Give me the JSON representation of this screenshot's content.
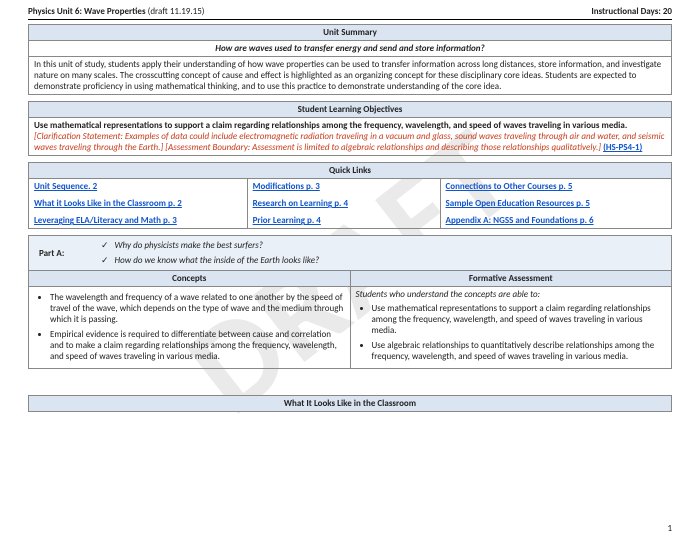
{
  "header": {
    "title_bold": "Physics Unit 6: Wave Properties",
    "title_paren": " (draft 11.19.15)",
    "right": "Instructional Days: 20"
  },
  "summary": {
    "band": "Unit Summary",
    "question": "How are waves used to transfer energy and send and store information?",
    "body": "In this unit of study, students apply their understanding of how wave properties can be used to transfer information across long distances, store information, and investigate nature on many scales. The crosscutting concept of cause and effect is highlighted as an organizing concept for these disciplinary core ideas. Students are expected to demonstrate proficiency in using mathematical thinking, and to use this practice to demonstrate understanding of the core idea."
  },
  "slo": {
    "band": "Student Learning Objectives",
    "main": "Use mathematical representations to support a claim regarding relationships among the frequency, wavelength, and speed of waves traveling in various media.",
    "clarification": "[Clarification Statement:  Examples of data could include electromagnetic radiation traveling in a vacuum and glass, sound waves traveling through air and water, and seismic waves traveling through the Earth.] [Assessment Boundary:  Assessment is limited to algebraic relationships and describing those relationships qualitatively.]",
    "code": "(HS-PS4-1)"
  },
  "quicklinks": {
    "band": "Quick Links",
    "col1": [
      "Unit Sequence. 2",
      "What it Looks Like in the Classroom p. 2",
      "Leveraging ELA/Literacy and Math  p. 3"
    ],
    "col2": [
      "Modifications p. 3",
      "Research on Learning p. 4",
      "Prior Learning p. 4"
    ],
    "col3": [
      "Connections to Other Courses p. 5",
      "Sample Open Education Resources p. 5",
      "Appendix A: NGSS and Foundations p. 6"
    ]
  },
  "partA": {
    "label": "Part A:",
    "q1": "Why do physicists make the best surfers?",
    "q2": "How do we know what the inside of the Earth looks like?"
  },
  "concepts": {
    "band": "Concepts",
    "items": [
      "The wavelength and frequency of a wave related to one another by the speed of travel of the wave, which depends on the type of wave and the medium through which it is passing.",
      "Empirical evidence is required to differentiate between cause and correlation and to make a claim regarding relationships among the frequency, wavelength, and speed of waves traveling in various media."
    ]
  },
  "formative": {
    "band": "Formative Assessment",
    "intro": "Students who understand the concepts are able to:",
    "items": [
      "Use mathematical representations to support a claim regarding relationships among the frequency, wavelength, and speed of waves traveling in various media.",
      "Use algebraic relationships to quantitatively describe relationships among the frequency, wavelength, and speed of waves traveling in various media."
    ]
  },
  "bottom_band": "What It Looks Like in the Classroom",
  "page_number": "1"
}
